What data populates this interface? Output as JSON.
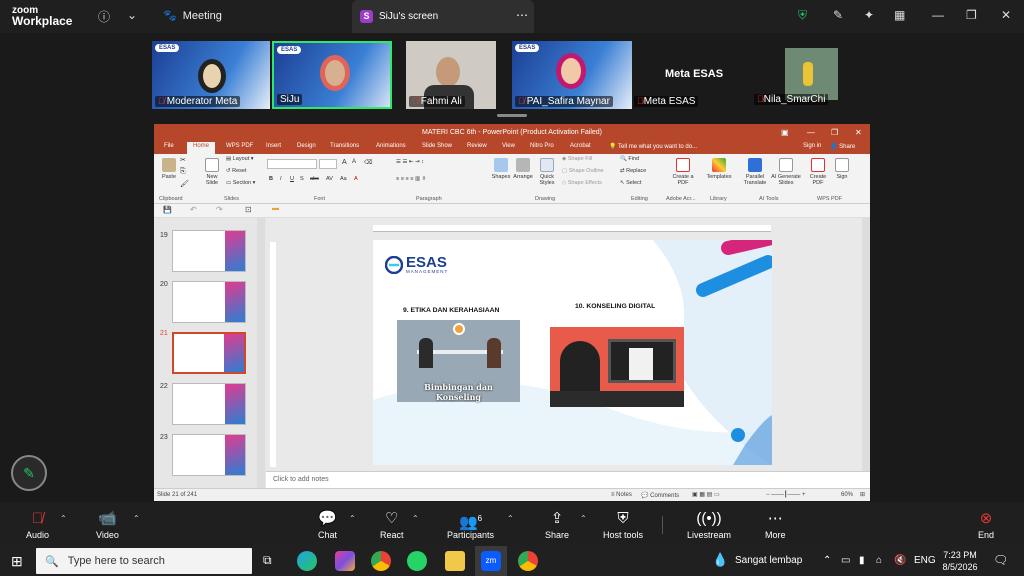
{
  "zoom": {
    "logo_line1": "zoom",
    "logo_line2": "Workplace",
    "meeting_label": "Meeting",
    "screen_badge": "S",
    "screen_tab": "SiJu's screen",
    "colors": {
      "accent": "#00c853",
      "danger": "#e53935",
      "brand_purple": "#9c3cc8"
    }
  },
  "participants": [
    {
      "name": "Moderator Meta",
      "muted": true,
      "esas": true
    },
    {
      "name": "SiJu",
      "muted": false,
      "esas": true,
      "active_speaker": true
    },
    {
      "name": "Fahmi Ali",
      "muted": true,
      "esas": false
    },
    {
      "name": "PAI_Safira Maynar",
      "muted": true,
      "esas": true
    },
    {
      "name": "Meta ESAS",
      "muted": true,
      "esas": false,
      "no_video": true
    },
    {
      "name": "Nila_SmarChi",
      "muted": true,
      "esas": false
    }
  ],
  "ppt": {
    "title": "MATERI CBC 6th - PowerPoint (Product Activation Failed)",
    "tabs": [
      "File",
      "Home",
      "WPS PDF",
      "Insert",
      "Design",
      "Transitions",
      "Animations",
      "Slide Show",
      "Review",
      "View",
      "Nitro Pro",
      "Acrobat"
    ],
    "active_tab": "Home",
    "tell_me": "Tell me what you want to do...",
    "sign_in": "Sign in",
    "share": "Share",
    "groups": [
      "Clipboard",
      "Slides",
      "Font",
      "Paragraph",
      "Drawing",
      "Editing",
      "Adobe Acr...",
      "Library",
      "AI Tools",
      "WPS PDF"
    ],
    "buttons": {
      "paste": "Paste",
      "new_slide": "New Slide",
      "layout": "Layout",
      "reset": "Reset",
      "section": "Section",
      "shapes": "Shapes",
      "arrange": "Arrange",
      "quick_styles": "Quick Styles",
      "shape_fill": "Shape Fill",
      "shape_outline": "Shape Outline",
      "shape_effects": "Shape Effects",
      "find": "Find",
      "replace": "Replace",
      "select": "Select",
      "create_pdf": "Create a PDF",
      "templates": "Templates",
      "parallel_translate": "Parallel Translate",
      "ai_generate": "AI Generate Slides",
      "create_pdf2": "Create PDF",
      "sign": "Sign"
    },
    "thumbnails": [
      {
        "num": "19"
      },
      {
        "num": "20"
      },
      {
        "num": "21",
        "selected": true
      },
      {
        "num": "22"
      },
      {
        "num": "23"
      }
    ],
    "notes_placeholder": "Click to add notes",
    "status_left": "Slide 21 of 241",
    "status_notes": "Notes",
    "status_comments": "Comments",
    "zoom_level": "60%",
    "slide": {
      "logo": "ESAS",
      "logo_sub": "MANAGEMENT",
      "heading_left": "9. ETIKA DAN KERAHASIAAN",
      "heading_right": "10. KONSELING DIGITAL",
      "caption_left": "Bimbingan dan Konseling"
    }
  },
  "toolbar": {
    "audio": "Audio",
    "video": "Video",
    "chat": "Chat",
    "react": "React",
    "participants": "Participants",
    "participants_count": "6",
    "share": "Share",
    "host_tools": "Host tools",
    "livestream": "Livestream",
    "more": "More",
    "end": "End"
  },
  "taskbar": {
    "search_placeholder": "Type here to search",
    "weather": "Sangat lembap",
    "lang": "ENG",
    "time": "7:23 PM",
    "date": "8/5/2026"
  }
}
